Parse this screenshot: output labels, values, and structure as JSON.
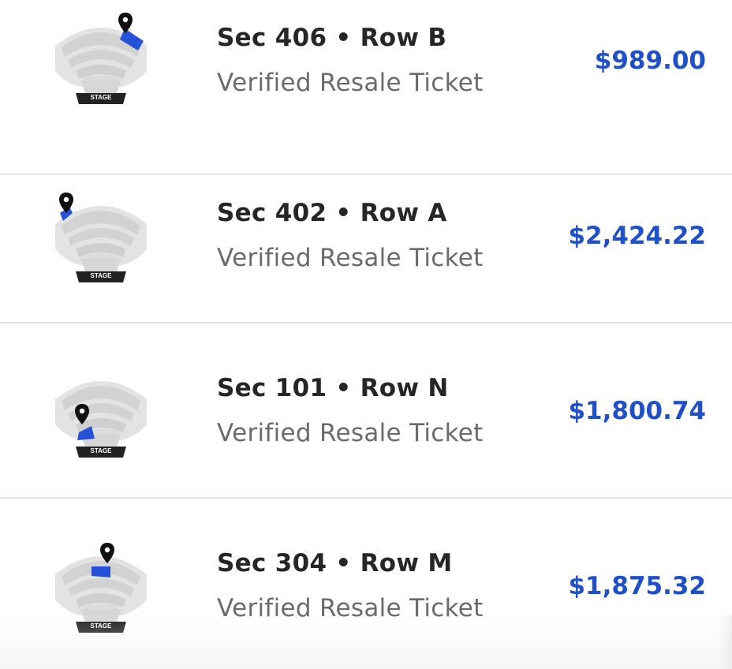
{
  "colors": {
    "price": "#1f4fc9",
    "section_highlight": "#2451d6",
    "pin": "#111111",
    "map_fill": "#d9d9d9",
    "stage": "#222222"
  },
  "listings": [
    {
      "map_icon": "venue-map-icon",
      "highlight": "upper-right",
      "title": "Sec 406 • Row B",
      "subtitle": "Verified Resale Ticket",
      "price": "$989.00",
      "stage_label": "STAGE"
    },
    {
      "map_icon": "venue-map-icon",
      "highlight": "upper-left",
      "title": "Sec 402 • Row A",
      "subtitle": "Verified Resale Ticket",
      "price": "$2,424.22",
      "stage_label": "STAGE"
    },
    {
      "map_icon": "venue-map-icon",
      "highlight": "floor-front",
      "title": "Sec 101 • Row N",
      "subtitle": "Verified Resale Ticket",
      "price": "$1,800.74",
      "stage_label": "STAGE"
    },
    {
      "map_icon": "venue-map-icon",
      "highlight": "mid-center",
      "title": "Sec 304 • Row M",
      "subtitle": "Verified Resale Ticket",
      "price": "$1,875.32",
      "stage_label": "STAGE"
    }
  ]
}
